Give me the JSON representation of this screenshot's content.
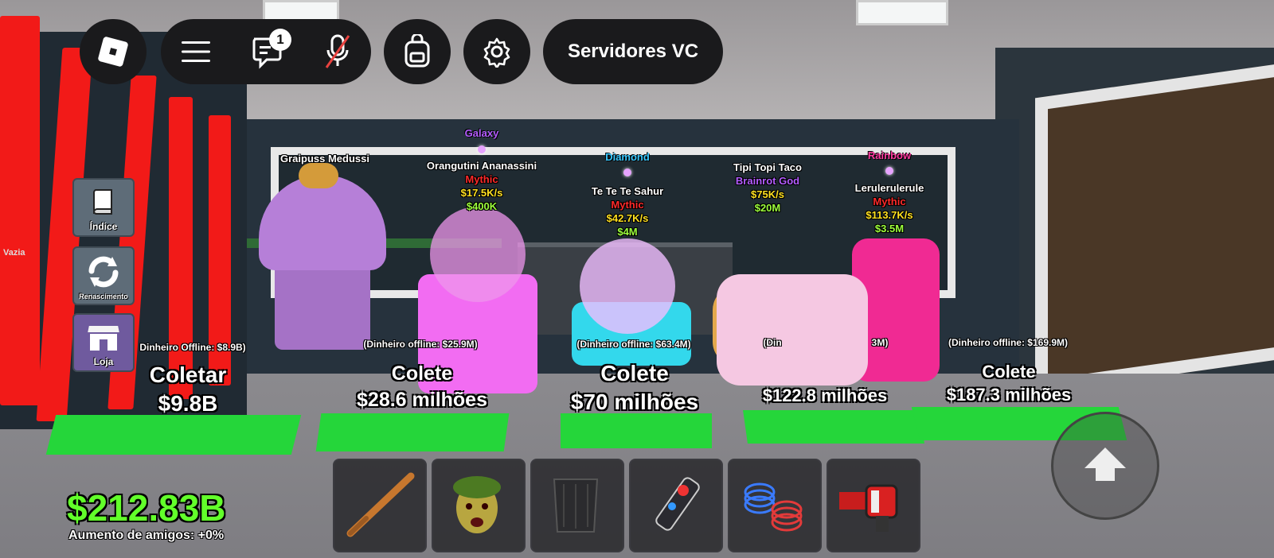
{
  "topbar": {
    "roblox_menu": "roblox-logo-icon",
    "chat_badge": "1",
    "servers_label": "Servidores VC"
  },
  "side_menu": [
    {
      "label": "Índice",
      "icon": "book-icon"
    },
    {
      "label": "Renascimento",
      "icon": "rebirth-icon"
    },
    {
      "label": "Loja",
      "icon": "shop-icon"
    }
  ],
  "brainrots": [
    {
      "name": "Graipuss Medussi"
    },
    {
      "mutation": "Galaxy",
      "name": "Orangutini Ananassini",
      "rarity": "Mythic",
      "rate": "$17.5K/s",
      "price": "$400K"
    },
    {
      "mutation": "Diamond",
      "name": "Te Te Te Sahur",
      "rarity": "Mythic",
      "rate": "$42.7K/s",
      "price": "$4M"
    },
    {
      "name": "Tipi Topi Taco",
      "rarity": "Brainrot God",
      "rate": "$75K/s",
      "price": "$20M"
    },
    {
      "mutation": "Rainbow",
      "name": "Lerulerulerule",
      "rarity": "Mythic",
      "rate": "$113.7K/s",
      "price": "$3.5M"
    }
  ],
  "collect_boards": [
    {
      "offline": "Dinheiro Offline: $8.9B)",
      "action": "Coletar",
      "amount": "$9.8B"
    },
    {
      "offline": "(Dinheiro offline: $25.9M)",
      "action": "Colete",
      "amount": "$28.6 milhões"
    },
    {
      "offline": "(Dinheiro offline: $63.4M)",
      "action": "Colete",
      "amount": "$70 milhões"
    },
    {
      "offline": "(Din",
      "offline_tail": "3M)",
      "action": "",
      "amount": "$122.8 milhões"
    },
    {
      "offline": "(Dinheiro offline: $169.9M)",
      "action": "Colete",
      "amount": "$187.3 milhões"
    }
  ],
  "left_sign": "Vazia",
  "player": {
    "money": "$212.83B",
    "friends_boost": "Aumento de amigos: +0%"
  },
  "hotbar": [
    {
      "item": "baseball-bat-icon"
    },
    {
      "item": "medusa-head-icon"
    },
    {
      "item": "invisibility-cloak-icon"
    },
    {
      "item": "quantum-cloner-icon"
    },
    {
      "item": "speed-coil-icon"
    },
    {
      "item": "laser-cannon-icon"
    }
  ],
  "colors": {
    "money": "#62ff2a",
    "mythic": "#ff2a2a",
    "rate": "#ffe020",
    "price": "#9dff3c",
    "galaxy": "#b45cff",
    "diamond": "#39c8ff",
    "rainbow": "#ff3ca0",
    "brainrot_god": "#b35cff"
  }
}
